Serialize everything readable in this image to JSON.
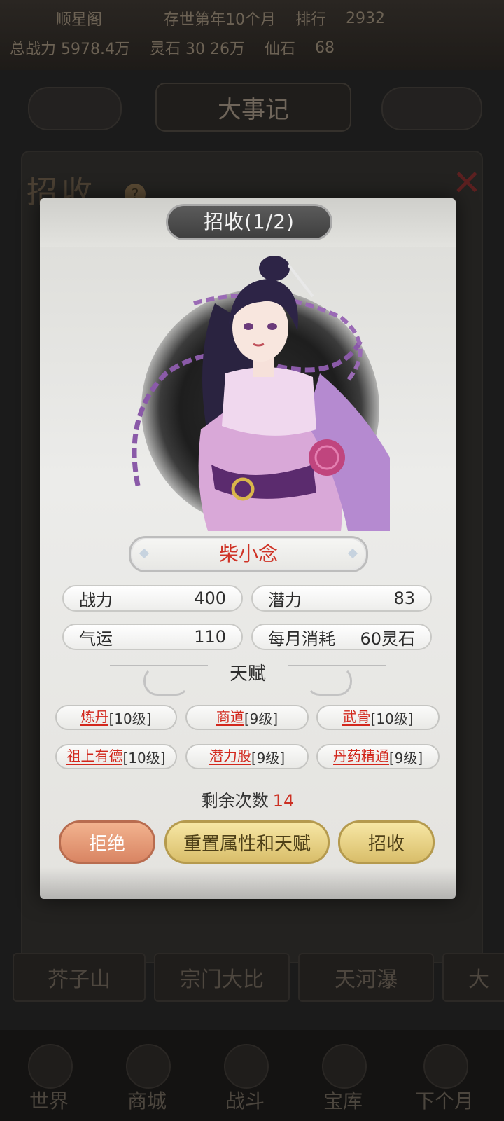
{
  "background": {
    "top_row1": [
      "顺星阁",
      "存世第年10个月",
      "排行",
      "2932"
    ],
    "top_row2": [
      "总战力 5978.4万",
      "灵石 30 26万",
      "仙石",
      "68"
    ],
    "tabs": {
      "left": "",
      "center": "大事记",
      "right": ""
    },
    "panel_title": "招收",
    "help_icon": "?",
    "bottom_tabs": [
      "芥子山",
      "宗门大比",
      "天河瀑",
      "大"
    ],
    "nav": [
      "世界",
      "商城",
      "战斗",
      "宝库",
      "下个月"
    ]
  },
  "modal": {
    "title": "招收(1/2)",
    "name": "柴小念",
    "stats": [
      {
        "label": "战力",
        "value": "400"
      },
      {
        "label": "潜力",
        "value": "83"
      },
      {
        "label": "气运",
        "value": "110"
      },
      {
        "label": "每月消耗",
        "value": "60灵石"
      }
    ],
    "talent_title": "天赋",
    "talents": [
      {
        "name": "炼丹",
        "level": "[10级]"
      },
      {
        "name": "商道",
        "level": "[9级]"
      },
      {
        "name": "武骨",
        "level": "[10级]"
      },
      {
        "name": "祖上有德",
        "level": "[10级]"
      },
      {
        "name": "潜力股",
        "level": "[9级]"
      },
      {
        "name": "丹药精通",
        "level": "[9级]"
      }
    ],
    "remaining_label": "剩余次数",
    "remaining_count": "14",
    "buttons": {
      "refuse": "拒绝",
      "reset": "重置属性和天赋",
      "recruit": "招收"
    }
  },
  "colors": {
    "accent_red": "#cf3326",
    "gold_button": "#d9be6a",
    "refuse_button": "#d98563"
  }
}
